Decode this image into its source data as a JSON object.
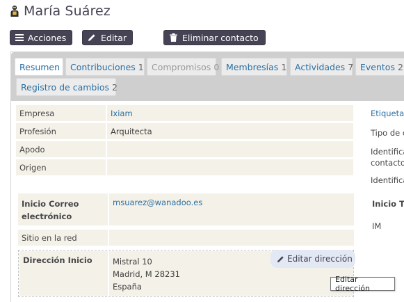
{
  "header": {
    "title": "María Suárez"
  },
  "actions": {
    "acciones": "Acciones",
    "editar": "Editar",
    "eliminar": "Eliminar contacto"
  },
  "tabs": [
    {
      "label": "Resumen",
      "count": ""
    },
    {
      "label": "Contribuciones",
      "count": "1"
    },
    {
      "label": "Compromisos",
      "count": "0"
    },
    {
      "label": "Membresías",
      "count": "1"
    },
    {
      "label": "Actividades",
      "count": "7"
    },
    {
      "label": "Eventos",
      "count": "2"
    },
    {
      "label": "Registro de cambios",
      "count": "2"
    }
  ],
  "left": {
    "empresa_label": "Empresa",
    "empresa_value": "Ixiam",
    "profesion_label": "Profesión",
    "profesion_value": "Arquitecta",
    "apodo_label": "Apodo",
    "apodo_value": "",
    "origen_label": "Origen",
    "origen_value": "",
    "email_label": "Inicio Correo electrónico",
    "email_value": "msuarez@wanadoo.es",
    "sitio_label": "Sitio en la red",
    "sitio_value": "",
    "direccion_label": "Dirección Inicio",
    "direccion_line1": "Mistral 10",
    "direccion_line2": "Madrid, M 28231",
    "direccion_line3": "España",
    "editar_direccion": "Editar dirección"
  },
  "right": {
    "etiquetas": "Etiquetas",
    "tipo": "Tipo de c",
    "identifica1_line1": "Identifica",
    "identifica1_line2": "contacto",
    "identifica2": "Identifica",
    "inicio_t": "Inicio T",
    "im": "IM"
  },
  "tooltip": {
    "text": "Editar dirección"
  }
}
